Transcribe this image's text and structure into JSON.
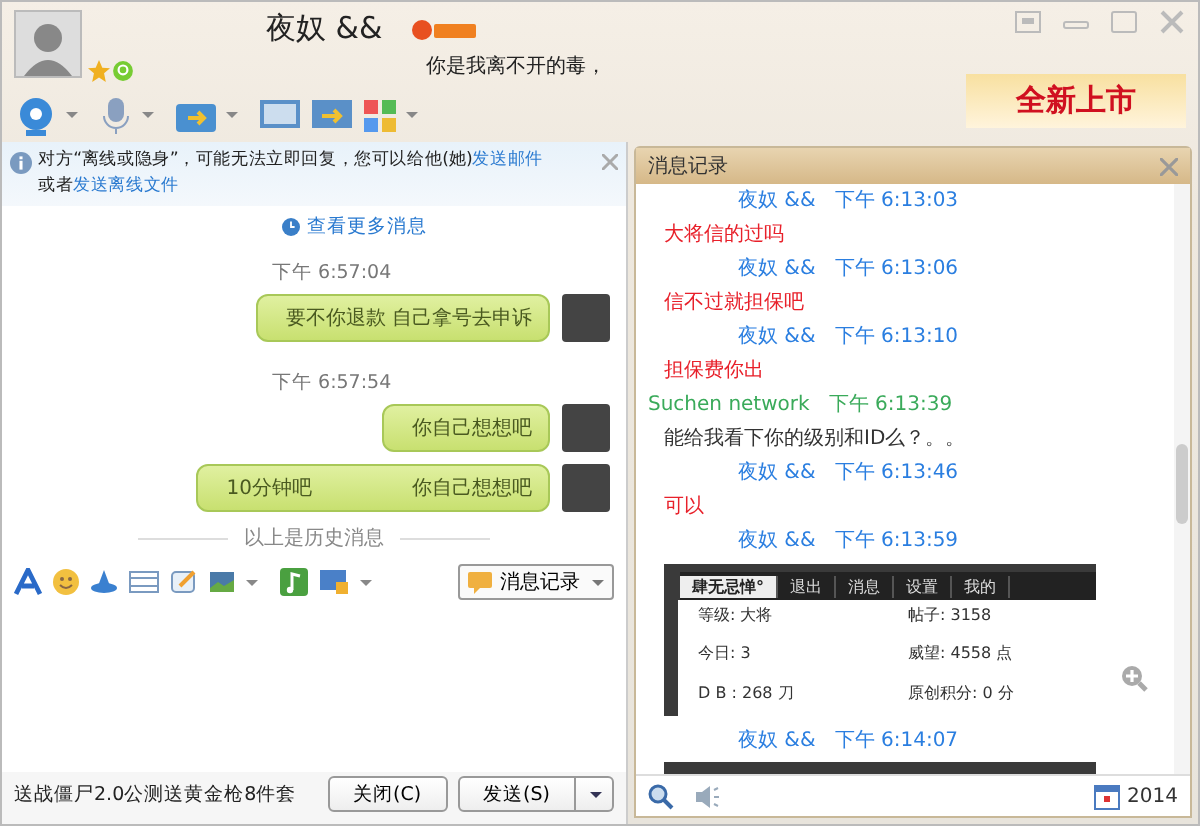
{
  "header": {
    "name": "夜奴 &&",
    "signature": "你是我离不开的毒，",
    "ad": "全新上市"
  },
  "notice": {
    "text": "对方“离线或隐身”，可能无法立即回复，您可以给他(她)",
    "link": "发送邮件",
    "text2": "或者",
    "link2": "发送离线文件"
  },
  "chat": {
    "more_link": "查看更多消息",
    "items": [
      {
        "kind": "time",
        "text": "下午 6:57:04"
      },
      {
        "kind": "bubble",
        "texts": [
          "要不你退款 自己拿号去申诉"
        ]
      },
      {
        "kind": "time",
        "text": "下午 6:57:54"
      },
      {
        "kind": "bubble",
        "texts": [
          "你自己想想吧"
        ]
      },
      {
        "kind": "bubble",
        "texts": [
          "10分钟吧",
          "你自己想想吧"
        ]
      }
    ],
    "divider": "以上是历史消息"
  },
  "input": {
    "history_button": "消息记录"
  },
  "footer": {
    "promo": "送战僵尸2.0公测送黄金枪8件套",
    "close_button": "关闭(C)",
    "send_button": "发送(S)"
  },
  "history": {
    "title": "消息记录",
    "items": [
      {
        "kind": "header",
        "sender": "夜奴  &&",
        "time": "下午 6:13:03",
        "color": "#2a7ee0"
      },
      {
        "kind": "text",
        "text": "大将信的过吗",
        "color": "#e8202a"
      },
      {
        "kind": "header",
        "sender": "夜奴  &&",
        "time": "下午 6:13:06",
        "color": "#2a7ee0"
      },
      {
        "kind": "text",
        "text": "信不过就担保吧",
        "color": "#e8202a"
      },
      {
        "kind": "header",
        "sender": "夜奴  &&",
        "time": "下午 6:13:10",
        "color": "#2a7ee0"
      },
      {
        "kind": "text",
        "text": "担保费你出",
        "color": "#e8202a"
      },
      {
        "kind": "header",
        "sender": "Suchen network",
        "time": "下午 6:13:39",
        "color": "#3aaa5a"
      },
      {
        "kind": "text",
        "text": "能给我看下你的级别和ID么？。。",
        "color": "#333333"
      },
      {
        "kind": "header",
        "sender": "夜奴  &&",
        "time": "下午 6:13:46",
        "color": "#2a7ee0"
      },
      {
        "kind": "text",
        "text": "可以",
        "color": "#e8202a"
      },
      {
        "kind": "header",
        "sender": "夜奴  &&",
        "time": "下午 6:13:59",
        "color": "#2a7ee0"
      },
      {
        "kind": "screenshot",
        "tabs": [
          "肆无忌惮°",
          "退出",
          "消息",
          "设置",
          "我的"
        ],
        "stats": [
          [
            "等级: 大将",
            "帖子: 3158"
          ],
          [
            "今日: 3",
            "威望: 4558 点"
          ],
          [
            "D B : 268 刀",
            "原创积分: 0 分"
          ]
        ]
      },
      {
        "kind": "header",
        "sender": "夜奴  &&",
        "time": "下午 6:14:07",
        "color": "#2a7ee0"
      },
      {
        "kind": "image"
      }
    ],
    "date": "2014"
  }
}
